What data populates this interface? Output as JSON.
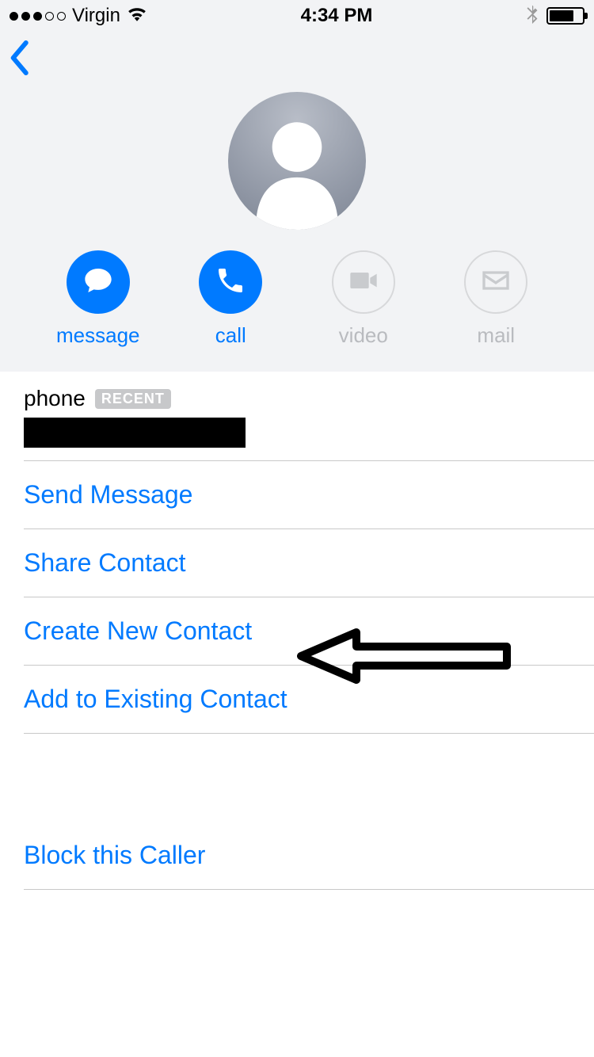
{
  "status": {
    "carrier": "Virgin",
    "time": "4:34 PM"
  },
  "actions": {
    "message": "message",
    "call": "call",
    "video": "video",
    "mail": "mail"
  },
  "phone_section": {
    "label": "phone",
    "badge": "RECENT"
  },
  "rows": {
    "send_message": "Send Message",
    "share_contact": "Share Contact",
    "create_new_contact": "Create New Contact",
    "add_existing": "Add to Existing Contact",
    "block": "Block this Caller"
  }
}
